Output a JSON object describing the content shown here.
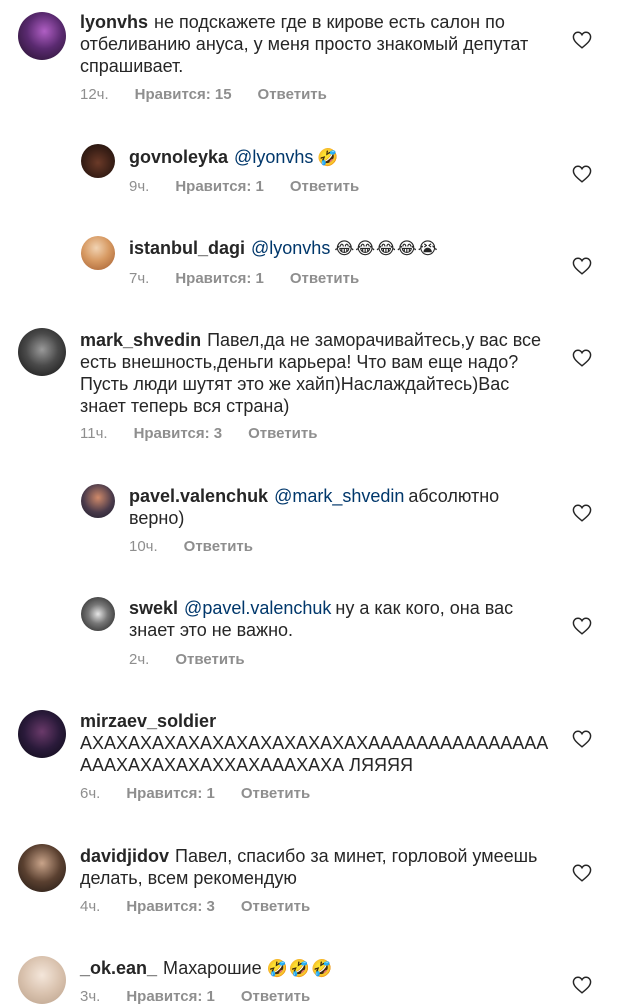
{
  "comments": [
    {
      "user": "lyonvhs",
      "mention": "",
      "text": "не подскажете где в кирове есть салон по отбеливанию ануса, у меня просто знакомый депутат спрашивает.",
      "emoji": "",
      "time": "12ч.",
      "likes": "Нравится: 15",
      "reply": "Ответить"
    },
    {
      "user": "govnoleyka",
      "mention": "@lyonvhs",
      "text": "",
      "emoji": "🤣",
      "time": "9ч.",
      "likes": "Нравится: 1",
      "reply": "Ответить"
    },
    {
      "user": "istanbul_dagi",
      "mention": "@lyonvhs",
      "text": "",
      "emoji": "😂😂😂😂😭",
      "time": "7ч.",
      "likes": "Нравится: 1",
      "reply": "Ответить"
    },
    {
      "user": "mark_shvedin",
      "mention": "",
      "text": "Павел,да не заморачивайтесь,у вас все есть внешность,деньги карьера! Что вам еще надо? Пусть люди шутят это же хайп)Наслаждайтесь)Вас знает теперь вся страна)",
      "emoji": "",
      "time": "11ч.",
      "likes": "Нравится: 3",
      "reply": "Ответить"
    },
    {
      "user": "pavel.valenchuk",
      "mention": "@mark_shvedin",
      "text": "абсолютно верно)",
      "emoji": "",
      "time": "10ч.",
      "likes": "",
      "reply": "Ответить"
    },
    {
      "user": "swekl",
      "mention": "@pavel.valenchuk",
      "text": "ну а как кого, она вас знает это не важно.",
      "emoji": "",
      "time": "2ч.",
      "likes": "",
      "reply": "Ответить"
    },
    {
      "user": "mirzaev_soldier",
      "mention": "",
      "text": "АХАХАХАХАХАХАХАХАХАХАХАХААААААААААААААААААХАХАХАХАХХАХАААХАХА ЛЯЯЯЯ",
      "emoji": "",
      "time": "6ч.",
      "likes": "Нравится: 1",
      "reply": "Ответить"
    },
    {
      "user": "davidjidov",
      "mention": "",
      "text": "Павел, спасибо за минет, горловой умеешь делать, всем рекомендую",
      "emoji": "",
      "time": "4ч.",
      "likes": "Нравится: 3",
      "reply": "Ответить"
    },
    {
      "user": "_ok.ean_",
      "mention": "",
      "text": "Махарошие",
      "emoji": "🤣🤣🤣",
      "time": "3ч.",
      "likes": "Нравится: 1",
      "reply": "Ответить"
    }
  ],
  "icons": {
    "like": "heart-outline-icon"
  }
}
